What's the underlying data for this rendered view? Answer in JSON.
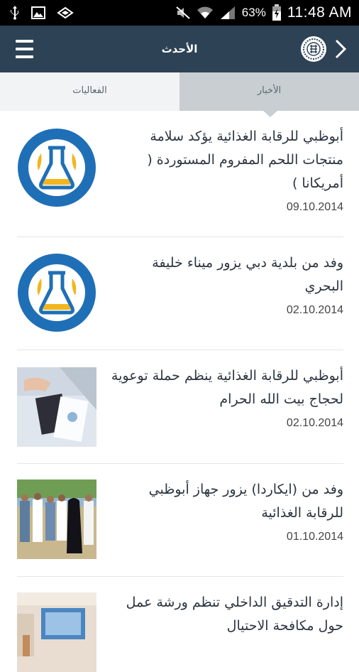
{
  "status_bar": {
    "battery_percent": "63%",
    "time": "11:48 AM",
    "icons": [
      "usb-icon",
      "image-icon",
      "sync-icon",
      "mute-icon",
      "wifi-icon",
      "signal-icon",
      "battery-icon"
    ]
  },
  "app_bar": {
    "title": "الأحدث",
    "icons": [
      "menu-icon",
      "logo-icon",
      "back-icon"
    ]
  },
  "tabs": [
    {
      "label": "الفعاليات",
      "selected": false
    },
    {
      "label": "الأخبار",
      "selected": true
    }
  ],
  "news": [
    {
      "headline": "أبوظبي للرقابة الغذائية يؤكد سلامة منتجات اللحم المفروم المستوردة ( أمريكانا )",
      "date": "09.10.2014",
      "thumb": "adfca-logo"
    },
    {
      "headline": "وفد من بلدية دبي يزور ميناء خليفة البحري",
      "date": "02.10.2014",
      "thumb": "adfca-logo"
    },
    {
      "headline": "أبوظبي للرقابة الغذائية ينظم حملة توعوية لحجاج بيت الله الحرام",
      "date": "02.10.2014",
      "thumb": "passport-photo"
    },
    {
      "headline": "وفد من (ايكاردا) يزور جهاز أبوظبي للرقابة الغذائية",
      "date": "01.10.2014",
      "thumb": "group-photo"
    },
    {
      "headline": "إدارة التدقيق الداخلي تنظم ورشة عمل حول مكافحة الاحتيال",
      "date": "",
      "thumb": "presentation-photo"
    }
  ],
  "colors": {
    "app_bar": "#2d4255",
    "tab_selected": "#c9ced2",
    "tab_unselected": "#f2f3f4",
    "logo_blue": "#1f6fb6",
    "logo_gold": "#f2b51c"
  }
}
